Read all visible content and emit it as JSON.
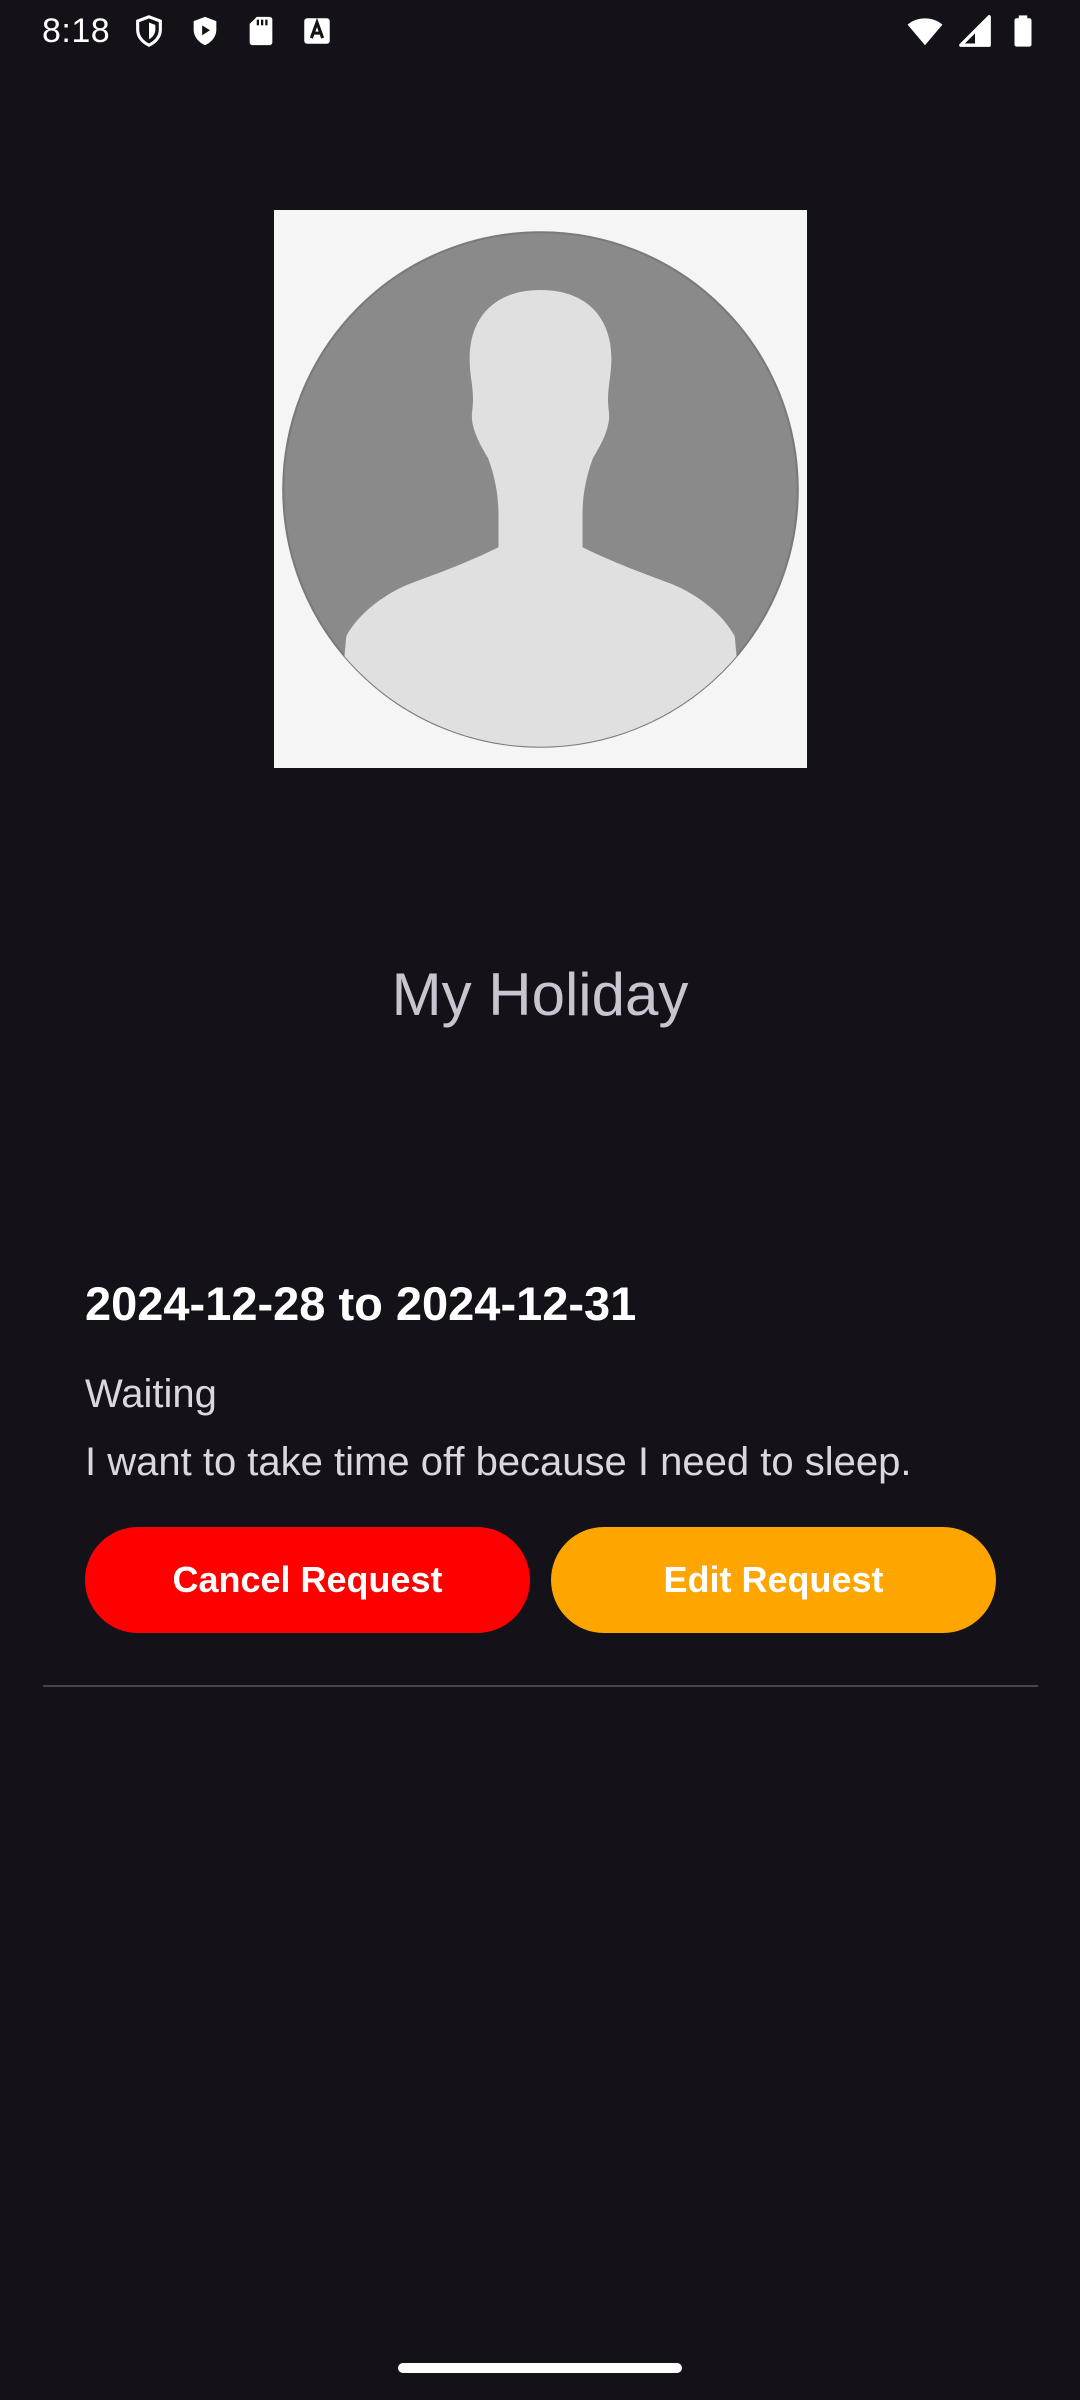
{
  "status_bar": {
    "time": "8:18",
    "left_icons": [
      "shield-icon",
      "play-protect-icon",
      "sd-card-icon",
      "keyboard-a-icon"
    ],
    "right_icons": [
      "wifi-icon",
      "signal-icon",
      "battery-icon"
    ]
  },
  "profile": {
    "avatar_icon": "default-avatar-icon"
  },
  "page": {
    "title": "My Holiday"
  },
  "requests": [
    {
      "dates": "2024-12-28 to 2024-12-31",
      "status": "Waiting",
      "reason": "I want to take time off because I need to sleep.",
      "cancel_label": "Cancel Request",
      "edit_label": "Edit Request"
    }
  ],
  "colors": {
    "background": "#141218",
    "cancel_button": "#ff0000",
    "edit_button": "#ffa500"
  }
}
